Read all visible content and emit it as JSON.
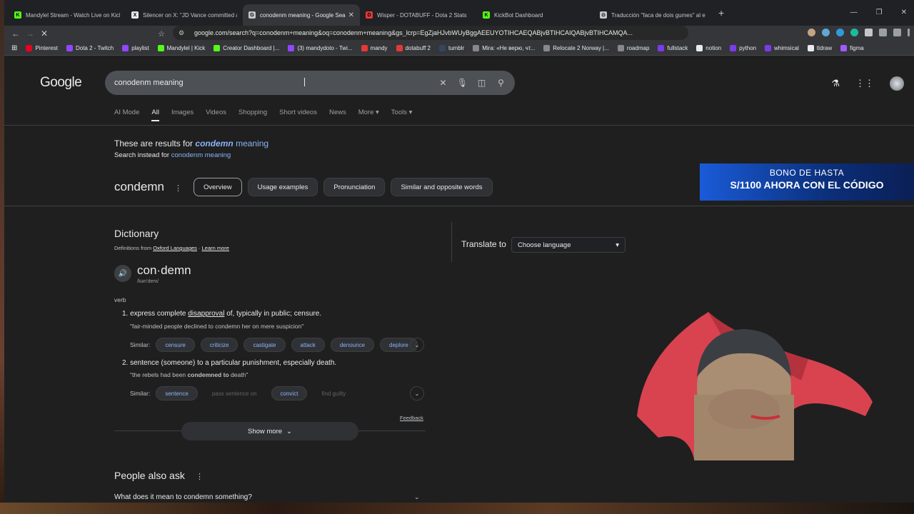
{
  "tabs": [
    {
      "title": "Mandylel Stream - Watch Live on Kick",
      "fav_color": "#53fc18",
      "fav_glyph": "K",
      "active": false
    },
    {
      "title": "Silencer on X: \"JD Vance committed a",
      "fav_color": "#e8eaed",
      "fav_glyph": "X",
      "active": false
    },
    {
      "title": "conodenm meaning - Google Search",
      "fav_color": "#c4c7c5",
      "fav_glyph": "G",
      "active": true,
      "close": "✕"
    },
    {
      "title": "Wisper - DOTABUFF - Dota 2 Stats",
      "fav_color": "#e53935",
      "fav_glyph": "D",
      "active": false
    },
    {
      "title": "KickBot Dashboard",
      "fav_color": "#53fc18",
      "fav_glyph": "K",
      "active": false
    },
    {
      "title": "Traducción \"faca de dois gumes\" al e",
      "fav_color": "#c4c7c5",
      "fav_glyph": "⊙",
      "active": false
    }
  ],
  "new_tab": "+",
  "window_controls": [
    "—",
    "❐",
    "✕"
  ],
  "nav": {
    "back": "←",
    "forward": "→",
    "reload": "✕"
  },
  "url": "google.com/search?q=conodenm+meaning&oq=conodenm+meaning&gs_lcrp=EgZjaHJvbWUyBggAEEUYOTIHCAEQABjvBTIHCAIQABjvBTIHCAMQA...",
  "bookmarks": [
    {
      "label": "Pinterest",
      "color": "#e60023"
    },
    {
      "label": "Dota 2 - Twitch",
      "color": "#9146ff"
    },
    {
      "label": "playlist",
      "color": "#9146ff"
    },
    {
      "label": "Mandylel | Kick",
      "color": "#53fc18"
    },
    {
      "label": "Creator Dashboard |...",
      "color": "#53fc18"
    },
    {
      "label": "(3) mandydoto - Twi...",
      "color": "#9146ff"
    },
    {
      "label": "mandy",
      "color": "#e53935"
    },
    {
      "label": "dotabuff 2",
      "color": "#e53935"
    },
    {
      "label": "tumblr",
      "color": "#35465c"
    },
    {
      "label": "Mira: «Не верю, чт...",
      "color": "#888"
    },
    {
      "label": "Relocate 2 Norway |...",
      "color": "#888"
    },
    {
      "label": "roadmap",
      "color": "#888"
    },
    {
      "label": "fullstack",
      "color": "#7c3aed"
    },
    {
      "label": "notion",
      "color": "#e8eaed"
    },
    {
      "label": "python",
      "color": "#7c3aed"
    },
    {
      "label": "whimsical",
      "color": "#7c3aed"
    },
    {
      "label": "tldraw",
      "color": "#e8eaed"
    },
    {
      "label": "figma",
      "color": "#a259ff"
    }
  ],
  "google": {
    "logo": "Google",
    "query": "conodenm meaning",
    "tabs": [
      "AI Mode",
      "All",
      "Images",
      "Videos",
      "Shopping",
      "Short videos",
      "News",
      "More ▾",
      "Tools ▾"
    ],
    "spell_prefix": "These are results for",
    "spell_corrected": "condemn",
    "spell_suffix": "meaning",
    "spell2_prefix": "Search instead for",
    "spell2_link": "conodenm meaning",
    "word": "condemn",
    "chips": [
      "Overview",
      "Usage examples",
      "Pronunciation",
      "Similar and opposite words"
    ],
    "dictionary_title": "Dictionary",
    "source_prefix": "Definitions from",
    "source_name": "Oxford Languages",
    "source_sep": "·",
    "learn_more": "Learn more",
    "headword": "con·demn",
    "phonetic": "/kən'dem/",
    "pos": "verb",
    "sense1_num": "1.",
    "sense1_pre": "express complete",
    "sense1_link": "disapproval",
    "sense1_post": "of, typically in public; censure.",
    "example1": "\"fair-minded people declined to condemn her on mere suspicion\"",
    "similar_label": "Similar:",
    "synonyms1": [
      "censure",
      "criticize",
      "castigate",
      "attack",
      "denounce",
      "deplore"
    ],
    "sense2_num": "2.",
    "sense2_text": "sentence (someone) to a particular punishment, especially death.",
    "example2_pre": "\"the rebels had been",
    "example2_bold": "condemned to",
    "example2_post": "death\"",
    "synonyms2": [
      {
        "label": "sentence",
        "dim": false
      },
      {
        "label": "pass sentence on",
        "dim": true
      },
      {
        "label": "convict",
        "dim": false
      },
      {
        "label": "find guilty",
        "dim": true
      }
    ],
    "feedback": "Feedback",
    "show_more": "Show more",
    "translate_label": "Translate to",
    "language_placeholder": "Choose language",
    "paa_title": "People also ask",
    "paa_question": "What does it mean to condemn something?"
  },
  "ad": {
    "line1": "BONO DE HASTA",
    "line2": "S/1100 AHORA CON EL CÓDIGO"
  }
}
